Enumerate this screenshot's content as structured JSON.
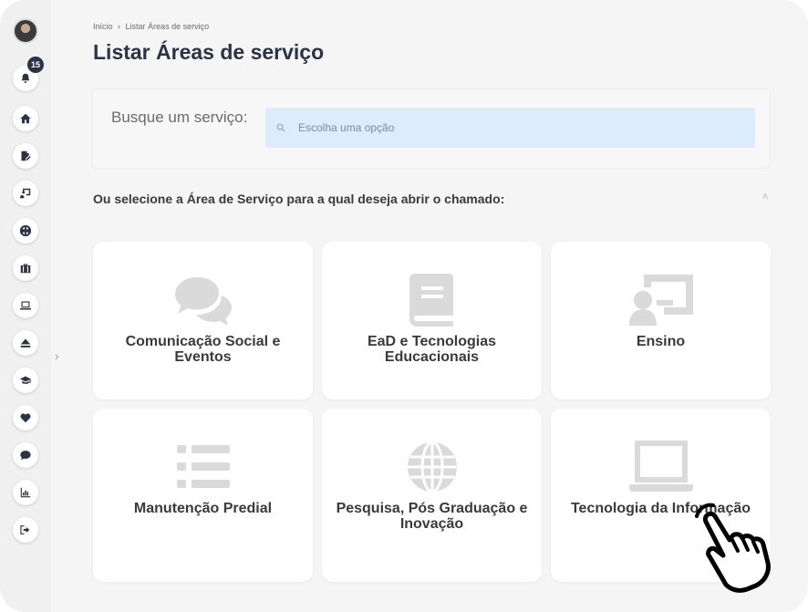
{
  "sidebar": {
    "notification_count": "15",
    "items": [
      {
        "name": "bell-icon"
      },
      {
        "name": "home-icon"
      },
      {
        "name": "edit-document-icon"
      },
      {
        "name": "presentation-icon"
      },
      {
        "name": "globe-icon"
      },
      {
        "name": "briefcase-icon"
      },
      {
        "name": "laptop-icon"
      },
      {
        "name": "eject-icon"
      },
      {
        "name": "graduation-cap-icon"
      },
      {
        "name": "heartbeat-icon"
      },
      {
        "name": "comment-icon"
      },
      {
        "name": "chart-icon"
      },
      {
        "name": "logout-icon"
      }
    ],
    "expand_icon": "›"
  },
  "breadcrumb": {
    "home": "Início",
    "separator": "›",
    "current": "Listar Áreas de serviço"
  },
  "page_title": "Listar Áreas de serviço",
  "search": {
    "label": "Busque um serviço:",
    "placeholder": "Escolha uma opção"
  },
  "select_prompt": "Ou selecione a Área de Serviço para a qual deseja abrir o chamado:",
  "collapse_icon": "˄",
  "cards": [
    {
      "label": "Comunicação Social e Eventos",
      "icon": "comments-icon"
    },
    {
      "label": "EaD e Tecnologias Educacionais",
      "icon": "book-icon"
    },
    {
      "label": "Ensino",
      "icon": "teacher-icon"
    },
    {
      "label": "Manutenção Predial",
      "icon": "list-icon"
    },
    {
      "label": "Pesquisa, Pós Graduação e Inovação",
      "icon": "globe-icon"
    },
    {
      "label": "Tecnologia da Informação",
      "icon": "laptop-icon"
    }
  ],
  "colors": {
    "brand_dark": "#2b3346",
    "search_bg": "#dcecfb",
    "card_icon": "#dadada"
  }
}
